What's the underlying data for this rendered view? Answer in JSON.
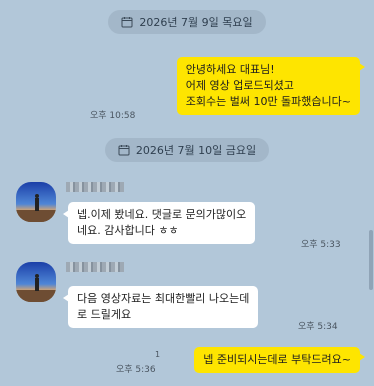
{
  "chat": {
    "date_1": "2026년 7월 9일 목요일",
    "date_2": "2026년 7월 10일 금요일",
    "messages": [
      {
        "lines": [
          "안녕하세요 대표님!",
          "어제 영상 업로드되셨고",
          "조회수는 벌써 10만 돌파했습니다~"
        ],
        "time": "오후 10:58"
      },
      {
        "lines": [
          "넵.이제 봤네요.  댓글로 문의가많이오",
          "네요. 감사합니다 ㅎㅎ"
        ],
        "time": "오후 5:33"
      },
      {
        "lines": [
          "다음 영상자료는 최대한빨리 나오는데",
          "로 드릴게요"
        ],
        "time": "오후 5:34"
      },
      {
        "lines": [
          "넵 준비되시는데로 부탁드려요~"
        ],
        "time": "오후 5:36",
        "unread": "1"
      }
    ]
  },
  "icons": {
    "date": "calendar-icon"
  },
  "colors": {
    "background": "#b2c7d9",
    "outgoing_bubble": "#fee500",
    "incoming_bubble": "#ffffff"
  }
}
